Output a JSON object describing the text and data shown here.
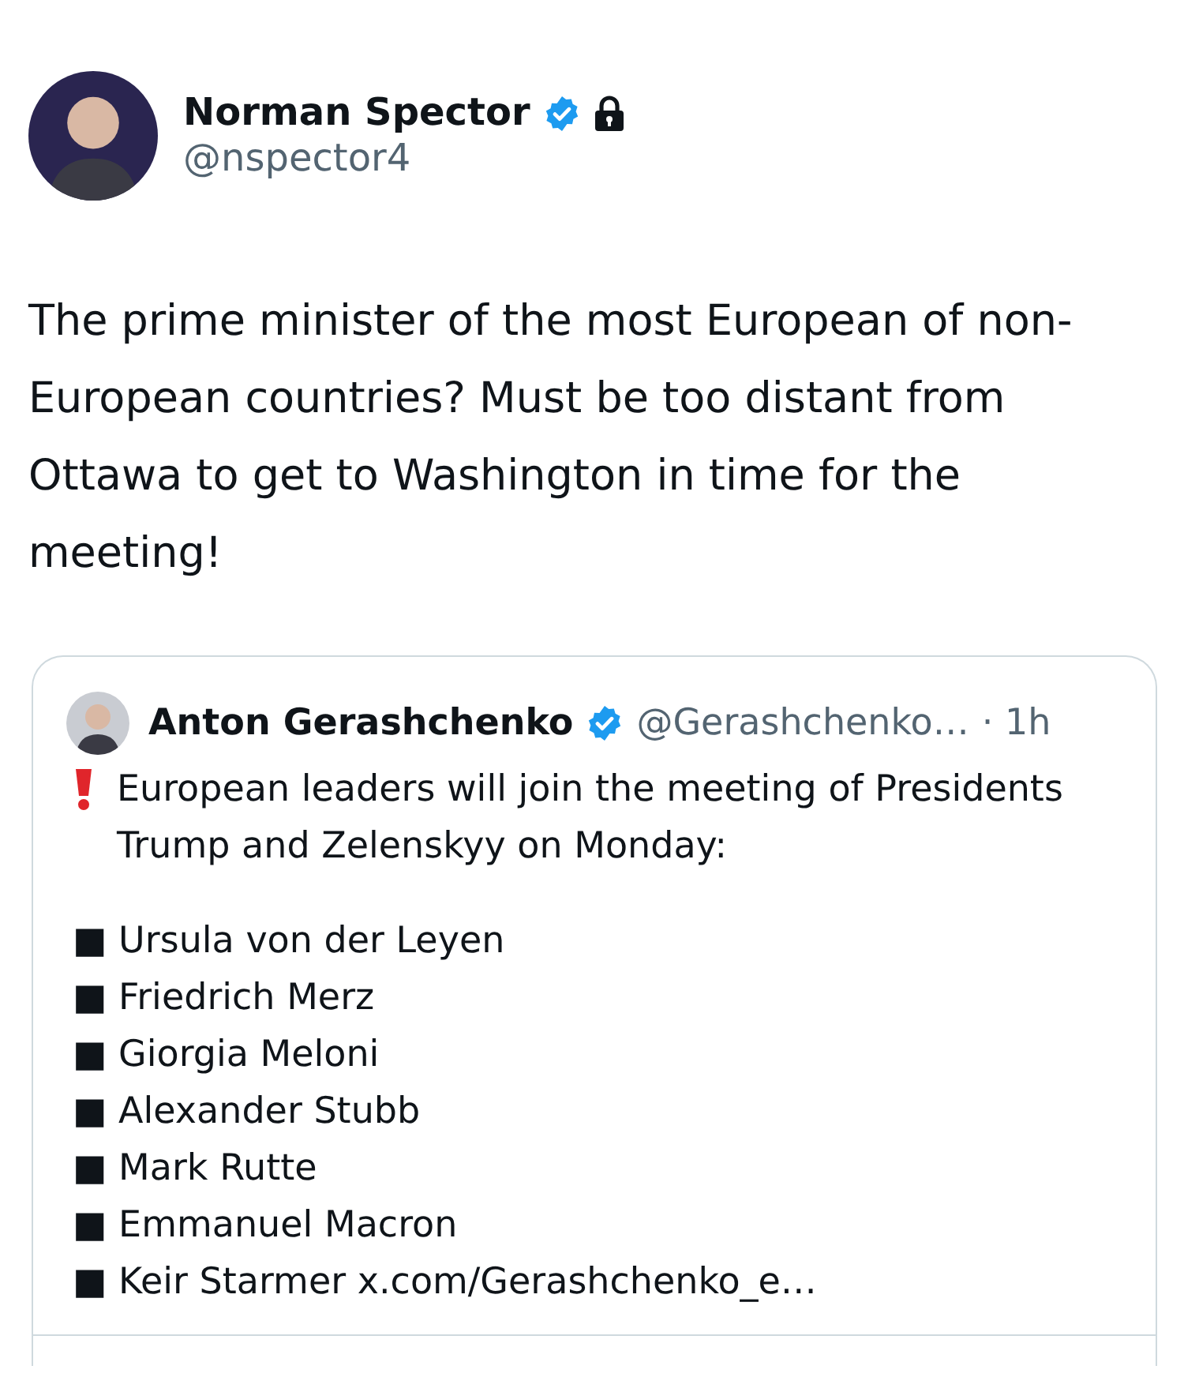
{
  "post": {
    "author": {
      "name": "Norman Spector",
      "verified": true,
      "protected": true,
      "handle": "@nspector4"
    },
    "text": "The prime minister of the most European of non-European countries? Must be too distant from Ottawa to get to Washington in time for the meeting!"
  },
  "quoted": {
    "author": {
      "name": "Anton Gerashchenko",
      "verified": true,
      "handle": "@Gerashchenko…"
    },
    "separator": "·",
    "time": "1h",
    "text": "European leaders will join the meeting of Presidents Trump and Zelenskyy on Monday:",
    "list": [
      "■ Ursula von der Leyen",
      "■ Friedrich Merz",
      "■ Giorgia Meloni",
      "■ Alexander Stubb",
      "■ Mark Rutte",
      "■ Emmanuel Macron",
      "■ Keir Starmer x.com/Gerashchenko_e…"
    ]
  }
}
